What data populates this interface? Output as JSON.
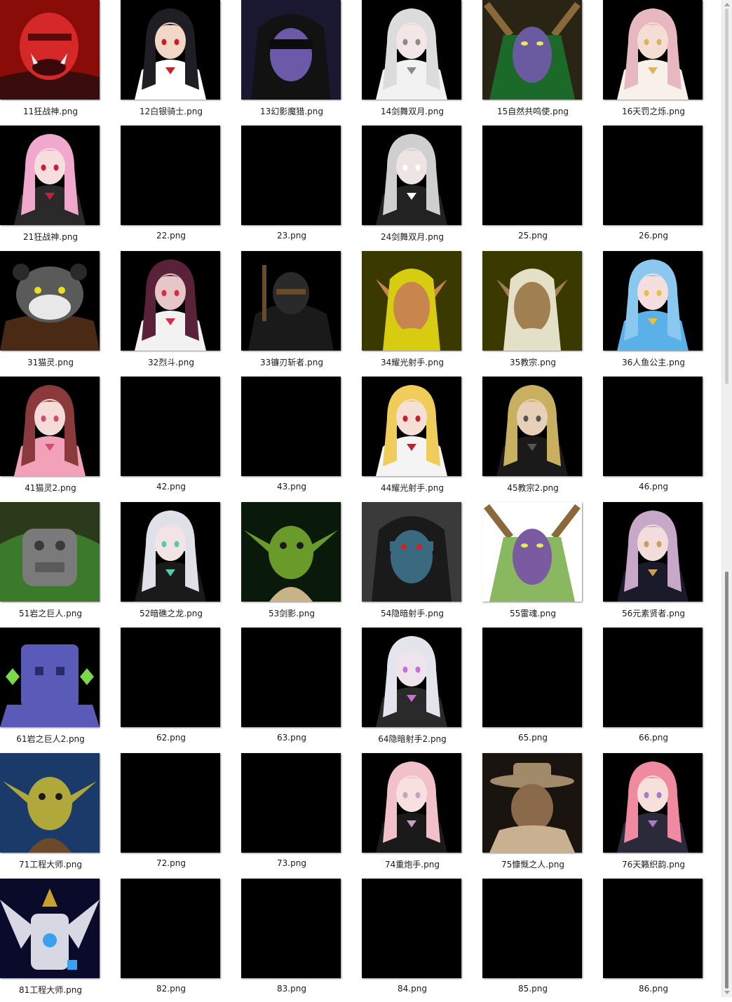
{
  "window": {
    "title": ""
  },
  "files": [
    {
      "name": "11狂战神.png",
      "portrait": {
        "kind": "orc",
        "bg": "#8a0c08",
        "skin": "#d62828",
        "accent": "#3a0d0d"
      }
    },
    {
      "name": "12白银骑士.png",
      "portrait": {
        "kind": "anime",
        "bg": "#000000",
        "skin": "#f2d6c6",
        "hair": "#1e1e24",
        "outfit": "#ffffff",
        "accent": "#c8202a"
      }
    },
    {
      "name": "13幻影魔猎.png",
      "portrait": {
        "kind": "hunter",
        "bg": "#1a1830",
        "skin": "#6c5aa8",
        "accent": "#121212"
      }
    },
    {
      "name": "14剑舞双月.png",
      "portrait": {
        "kind": "anime",
        "bg": "#000000",
        "skin": "#f3e6e6",
        "hair": "#dcdcdc",
        "outfit": "#f2f2f2",
        "accent": "#8a8a8a"
      }
    },
    {
      "name": "15自然共鸣使.png",
      "portrait": {
        "kind": "druid",
        "bg": "#2a2414",
        "skin": "#6a5aa0",
        "accent": "#1c6a2a"
      }
    },
    {
      "name": "16天罚之烁.png",
      "portrait": {
        "kind": "anime",
        "bg": "#000000",
        "skin": "#f4ddd4",
        "hair": "#e8b8c0",
        "outfit": "#f7f1ea",
        "accent": "#d8b45a"
      }
    },
    {
      "name": "21狂战神.png",
      "portrait": {
        "kind": "anime",
        "bg": "#000000",
        "skin": "#f6dede",
        "hair": "#f0a8cc",
        "outfit": "#2a2a2a",
        "accent": "#c81e3a"
      }
    },
    {
      "name": "22.png",
      "portrait": {
        "kind": "none",
        "bg": "#000000"
      }
    },
    {
      "name": "23.png",
      "portrait": {
        "kind": "none",
        "bg": "#000000"
      }
    },
    {
      "name": "24剑舞双月.png",
      "portrait": {
        "kind": "anime",
        "bg": "#000000",
        "skin": "#efe4e4",
        "hair": "#cfcfcf",
        "outfit": "#222222",
        "accent": "#ffffff"
      }
    },
    {
      "name": "25.png",
      "portrait": {
        "kind": "none",
        "bg": "#000000"
      }
    },
    {
      "name": "26.png",
      "portrait": {
        "kind": "none",
        "bg": "#000000"
      }
    },
    {
      "name": "31猫灵.png",
      "portrait": {
        "kind": "panda",
        "bg": "#000000",
        "skin": "#5a5a5a",
        "accent": "#4a2a14"
      }
    },
    {
      "name": "32烈斗.png",
      "portrait": {
        "kind": "anime",
        "bg": "#000000",
        "skin": "#e6c6c6",
        "hair": "#5a2238",
        "outfit": "#f2f2f2",
        "accent": "#d82a4a"
      }
    },
    {
      "name": "33镰刃斩者.png",
      "portrait": {
        "kind": "ninja",
        "bg": "#000000",
        "skin": "#2a2a2a",
        "accent": "#6a4a2a"
      }
    },
    {
      "name": "34耀光射手.png",
      "portrait": {
        "kind": "elf",
        "bg": "#3a3a00",
        "skin": "#c8864e",
        "accent": "#d8cc10"
      }
    },
    {
      "name": "35教宗.png",
      "portrait": {
        "kind": "elf",
        "bg": "#3a3a00",
        "skin": "#a08050",
        "accent": "#e4e0c8"
      }
    },
    {
      "name": "36人鱼公主.png",
      "portrait": {
        "kind": "anime",
        "bg": "#000000",
        "skin": "#f4dede",
        "hair": "#8ac8f0",
        "outfit": "#5ab0e8",
        "accent": "#e8c040"
      }
    },
    {
      "name": "41猫灵2.png",
      "portrait": {
        "kind": "anime",
        "bg": "#000000",
        "skin": "#f6dcd8",
        "hair": "#8a3a3a",
        "outfit": "#f2a2b8",
        "accent": "#d84a6a"
      }
    },
    {
      "name": "42.png",
      "portrait": {
        "kind": "none",
        "bg": "#000000"
      }
    },
    {
      "name": "43.png",
      "portrait": {
        "kind": "none",
        "bg": "#000000"
      }
    },
    {
      "name": "44耀光射手.png",
      "portrait": {
        "kind": "anime",
        "bg": "#000000",
        "skin": "#f6e0d6",
        "hair": "#f0cc5a",
        "outfit": "#f4f4f4",
        "accent": "#c8202a"
      }
    },
    {
      "name": "45教宗2.png",
      "portrait": {
        "kind": "anime",
        "bg": "#000000",
        "skin": "#e8d0b8",
        "hair": "#c8b060",
        "outfit": "#1a1a1a",
        "accent": "#555555"
      }
    },
    {
      "name": "46.png",
      "portrait": {
        "kind": "none",
        "bg": "#000000"
      }
    },
    {
      "name": "51岩之巨人.png",
      "portrait": {
        "kind": "golem",
        "bg": "#2a3a1a",
        "skin": "#7a7a7a",
        "accent": "#3a7a2a"
      }
    },
    {
      "name": "52暗礁之龙.png",
      "portrait": {
        "kind": "anime",
        "bg": "#000000",
        "skin": "#f2e4e4",
        "hair": "#e0e0e8",
        "outfit": "#1a1a1a",
        "accent": "#5ac8b0"
      }
    },
    {
      "name": "53剑影.png",
      "portrait": {
        "kind": "goblin",
        "bg": "#0a1a0a",
        "skin": "#6a9a2a",
        "accent": "#c8b488"
      }
    },
    {
      "name": "54隐暗射手.png",
      "portrait": {
        "kind": "hooded",
        "bg": "#3a3a3a",
        "skin": "#3a6a80",
        "accent": "#1a1a1a"
      }
    },
    {
      "name": "55雷魂.png",
      "portrait": {
        "kind": "druid",
        "bg": "#ffffff",
        "skin": "#7a5aa0",
        "accent": "#8ab860"
      }
    },
    {
      "name": "56元素贤者.png",
      "portrait": {
        "kind": "anime",
        "bg": "#000000",
        "skin": "#f2dcdc",
        "hair": "#c8a8c8",
        "outfit": "#1a1a2a",
        "accent": "#c8a05a"
      }
    },
    {
      "name": "61岩之巨人2.png",
      "portrait": {
        "kind": "block",
        "bg": "#000000",
        "skin": "#5a5ab8",
        "accent": "#7ad84a"
      }
    },
    {
      "name": "62.png",
      "portrait": {
        "kind": "none",
        "bg": "#000000"
      }
    },
    {
      "name": "63.png",
      "portrait": {
        "kind": "none",
        "bg": "#000000"
      }
    },
    {
      "name": "64隐暗射手2.png",
      "portrait": {
        "kind": "anime",
        "bg": "#000000",
        "skin": "#f0e4ec",
        "hair": "#e4e4ec",
        "outfit": "#2a2a2a",
        "accent": "#c870d8"
      }
    },
    {
      "name": "65.png",
      "portrait": {
        "kind": "none",
        "bg": "#000000"
      }
    },
    {
      "name": "66.png",
      "portrait": {
        "kind": "none",
        "bg": "#000000"
      }
    },
    {
      "name": "71工程大师.png",
      "portrait": {
        "kind": "goblin",
        "bg": "#1a3a6a",
        "skin": "#b0a83a",
        "accent": "#6a4a2a"
      }
    },
    {
      "name": "72.png",
      "portrait": {
        "kind": "none",
        "bg": "#000000"
      }
    },
    {
      "name": "73.png",
      "portrait": {
        "kind": "none",
        "bg": "#000000"
      }
    },
    {
      "name": "74重炮手.png",
      "portrait": {
        "kind": "anime",
        "bg": "#000000",
        "skin": "#f6e0e0",
        "hair": "#f2c0c8",
        "outfit": "#1a1a1a",
        "accent": "#c8a0c0"
      }
    },
    {
      "name": "75慷慨之人.png",
      "portrait": {
        "kind": "cowboy",
        "bg": "#1a1410",
        "skin": "#8a6a4a",
        "accent": "#a08a6a"
      }
    },
    {
      "name": "76天籁织韵.png",
      "portrait": {
        "kind": "anime",
        "bg": "#000000",
        "skin": "#f6e0dc",
        "hair": "#f08aa0",
        "outfit": "#2a2a3a",
        "accent": "#a87ac8"
      }
    },
    {
      "name": "81工程大师.png",
      "portrait": {
        "kind": "mech",
        "bg": "#0a0a2a",
        "skin": "#d8d8e4",
        "accent": "#3aa0f0"
      }
    },
    {
      "name": "82.png",
      "portrait": {
        "kind": "none",
        "bg": "#000000"
      }
    },
    {
      "name": "83.png",
      "portrait": {
        "kind": "none",
        "bg": "#000000"
      }
    },
    {
      "name": "84.png",
      "portrait": {
        "kind": "none",
        "bg": "#000000"
      }
    },
    {
      "name": "85.png",
      "portrait": {
        "kind": "none",
        "bg": "#000000"
      }
    },
    {
      "name": "86.png",
      "portrait": {
        "kind": "none",
        "bg": "#000000"
      }
    }
  ]
}
